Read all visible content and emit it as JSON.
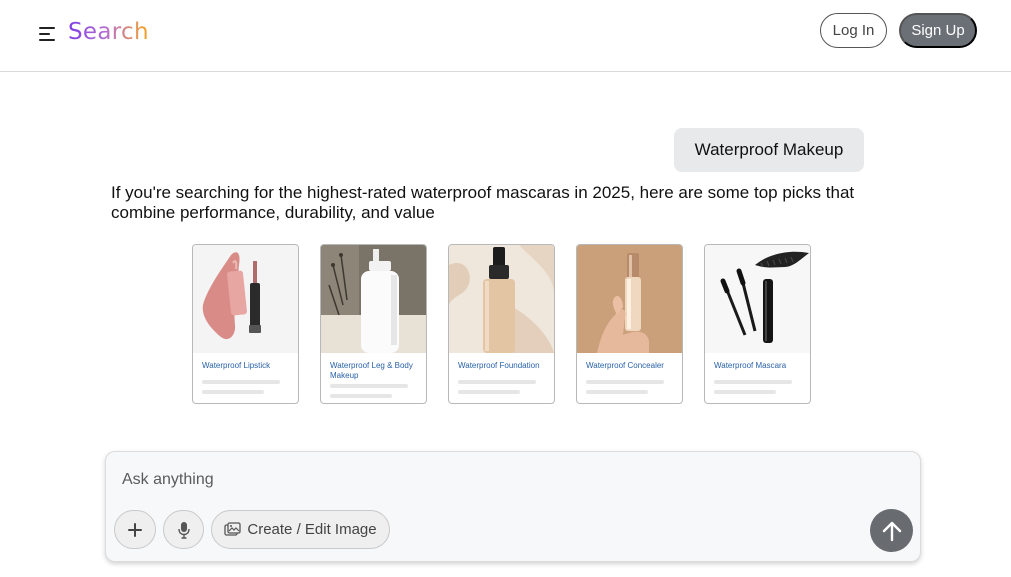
{
  "header": {
    "logo_text": "Search",
    "login_label": "Log In",
    "signup_label": "Sign Up",
    "icons": {
      "menu": "hamburger-menu-icon"
    }
  },
  "chat": {
    "user_query": "Waterproof Makeup",
    "answer_text": "If you're searching for the highest-rated waterproof mascaras in 2025, here are some top picks that combine performance, durability, and value"
  },
  "products": [
    {
      "title": "Waterproof Lipstick",
      "image": "lipstick-image"
    },
    {
      "title": "Waterproof Leg & Body Makeup",
      "image": "body-lotion-bottle-image"
    },
    {
      "title": "Waterproof Foundation",
      "image": "foundation-bottle-image"
    },
    {
      "title": "Waterproof Concealer",
      "image": "concealer-in-hand-image"
    },
    {
      "title": "Waterproof Mascara",
      "image": "mascara-wands-image"
    }
  ],
  "composer": {
    "placeholder": "Ask anything",
    "value": "",
    "create_image_label": "Create / Edit Image",
    "icons": {
      "add": "plus-icon",
      "mic": "microphone-icon",
      "image": "image-edit-icon",
      "send": "arrow-up-icon"
    }
  },
  "colors": {
    "logo_gradient": [
      "#7b3fe4",
      "#b46ad6",
      "#f5a623"
    ],
    "signup_bg": "#6b6f76",
    "send_bg": "#686b70",
    "card_title": "#2a62a8",
    "bubble_bg": "#e8e9eb"
  }
}
